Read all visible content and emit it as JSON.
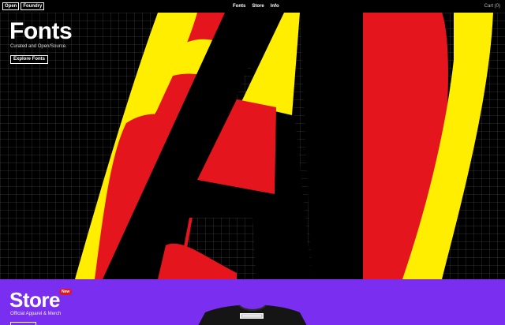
{
  "nav": {
    "logo": [
      "Open",
      "Foundry"
    ],
    "links": [
      "Fonts",
      "Store",
      "Info"
    ],
    "cart": "Cart (0)"
  },
  "hero": {
    "title": "Fonts",
    "subtitle": "Curated and Open/Source.",
    "button": "Explore Fonts"
  },
  "store": {
    "title": "Store",
    "badge": "New",
    "subtitle": "Official Apparel & Merch"
  },
  "colors": {
    "yellow": "#ffee00",
    "red": "#e5151d",
    "black": "#000000",
    "purple": "#7a2ff0"
  }
}
